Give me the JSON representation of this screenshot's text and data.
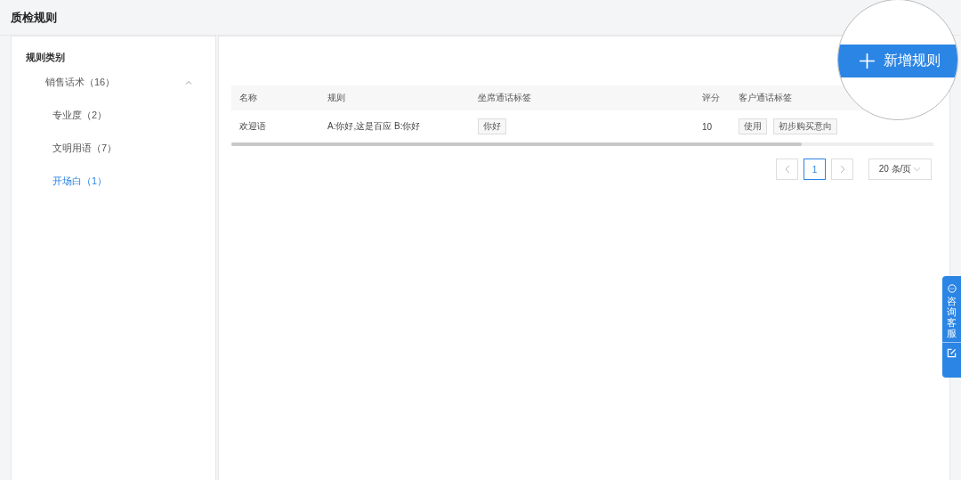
{
  "page_title": "质检规则",
  "sidebar": {
    "title": "规则类别",
    "items": [
      {
        "label": "销售话术（16）",
        "expanded": true,
        "selected": false,
        "children": [
          {
            "label": "专业度（2）",
            "selected": false
          },
          {
            "label": "文明用语（7）",
            "selected": false
          },
          {
            "label": "开场白（1）",
            "selected": true
          }
        ]
      }
    ]
  },
  "add_button": {
    "label": "新增规则"
  },
  "table": {
    "columns": [
      "名称",
      "规则",
      "坐席通话标签",
      "评分",
      "客户通话标签"
    ],
    "rows": [
      {
        "name": "欢迎语",
        "rule": "A:你好,这是百应 B:你好",
        "agent_tags": [
          "你好"
        ],
        "score": "10",
        "customer_tags": [
          "使用",
          "初步购买意向"
        ]
      }
    ]
  },
  "pagination": {
    "pages": [
      {
        "label": "1",
        "selected": true
      }
    ],
    "page_size": "20 条/页"
  },
  "side_tab": {
    "label": "咨询客服"
  }
}
